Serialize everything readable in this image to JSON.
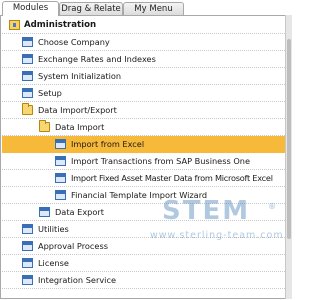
{
  "tabs": [
    {
      "label": "Modules",
      "active": true
    },
    {
      "label": "Drag & Relate",
      "active": false
    },
    {
      "label": "My Menu",
      "active": false
    }
  ],
  "tree": {
    "title": "Administration",
    "items": [
      {
        "label": "Choose Company",
        "icon": "form-icon"
      },
      {
        "label": "Exchange Rates and Indexes",
        "icon": "form-icon"
      },
      {
        "label": "System Initialization",
        "icon": "form-icon"
      },
      {
        "label": "Setup",
        "icon": "form-icon"
      },
      {
        "label": "Data Import/Export",
        "icon": "folder-open-icon"
      },
      {
        "label": "Data Import",
        "icon": "folder-open-icon"
      },
      {
        "label": "Import from Excel",
        "icon": "form-icon",
        "selected": true
      },
      {
        "label": "Import Transactions from SAP Business One",
        "icon": "form-icon"
      },
      {
        "label": "Import Fixed Asset Master Data from Microsoft Excel",
        "icon": "form-icon"
      },
      {
        "label": "Financial Template Import Wizard",
        "icon": "form-icon"
      },
      {
        "label": "Data Export",
        "icon": "form-icon"
      },
      {
        "label": "Utilities",
        "icon": "form-icon"
      },
      {
        "label": "Approval Process",
        "icon": "form-icon"
      },
      {
        "label": "License",
        "icon": "form-icon"
      },
      {
        "label": "Integration Service",
        "icon": "form-icon"
      }
    ]
  },
  "watermark": {
    "logo": "STEM",
    "registered": "®",
    "url": "www.sterling-team.com"
  },
  "colors": {
    "selection": "#f7b93a",
    "watermark": "#4f86ba"
  }
}
